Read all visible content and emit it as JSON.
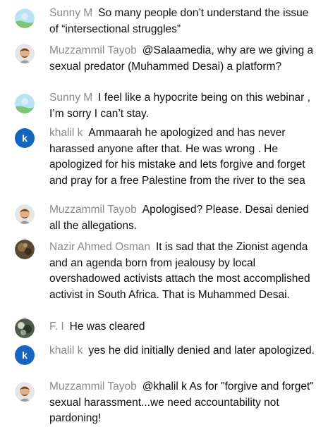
{
  "messages": [
    {
      "author": "Sunny M",
      "avatar": "sunny-globe-icon",
      "text": "So many people don’t understand the issue of “intersectional struggles”"
    },
    {
      "author": "Muzzammil Tayob",
      "avatar": "memoji-man-icon",
      "text": "@Salaamedia, why are we giving a sexual predator (Muhammed Desai) a platform?"
    },
    {
      "author": "Sunny M",
      "avatar": "sunny-globe-icon",
      "text": "I feel like a hypocrite being on this webinar , I’m sorry I can’t stay."
    },
    {
      "author": "khalil k",
      "avatar": "letter-k-icon",
      "avatar_letter": "k",
      "avatar_color": "#1565c0",
      "text": "Ammaarah he apologized and has never harassed anyone after that. He was wrong . He apologized for his mistake and lets forgive and forget and pray for a free Palestine from the river to the sea"
    },
    {
      "author": "Muzzammil Tayob",
      "avatar": "memoji-man-icon",
      "text": "Apologised? Please. Desai denied all the allegations."
    },
    {
      "author": "Nazir Ahmed Osman",
      "avatar": "photo-avatar-icon",
      "text": "It is sad that the Zionist agenda and an agenda born from jealousy by local overshadowed activists attach the most accomplished activist in South Africa. That is Muhammed Desai."
    },
    {
      "author": "F. I",
      "avatar": "photo-avatar-icon",
      "text": "He was cleared"
    },
    {
      "author": "khalil k",
      "avatar": "letter-k-icon",
      "avatar_letter": "k",
      "avatar_color": "#1565c0",
      "text": "yes he did initially denied and later apologized."
    },
    {
      "author": "Muzzammil Tayob",
      "avatar": "memoji-man-icon",
      "text": "@khalil k As for \"forgive and forget\" sexual harassment...we need accountability not pardoning!"
    }
  ]
}
